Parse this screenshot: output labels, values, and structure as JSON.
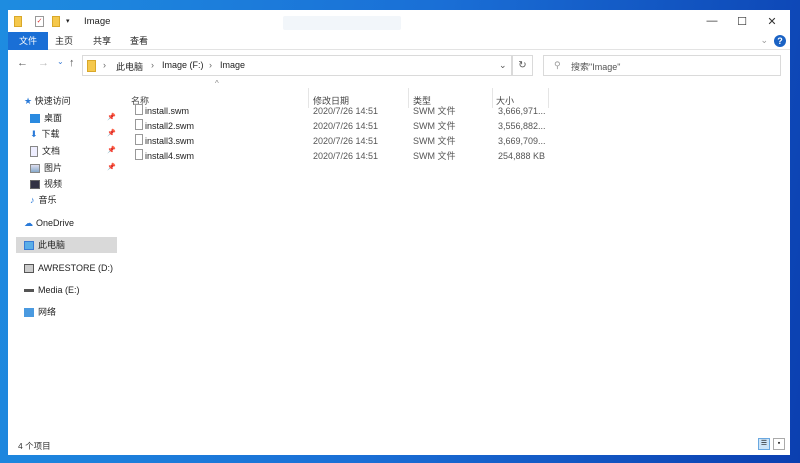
{
  "window": {
    "title": "Image",
    "minimize": "—",
    "maximize": "☐",
    "close": "✕"
  },
  "ribbon": {
    "tabs": [
      "文件",
      "主页",
      "共享",
      "查看"
    ],
    "help": "?",
    "expand": "⌄"
  },
  "nav": {
    "back": "←",
    "forward": "→",
    "recent": "⌄",
    "up": "↑"
  },
  "address": {
    "crumbs": [
      "此电脑",
      "Image (F:)",
      "Image"
    ],
    "sep": "›",
    "dropdown": "⌄",
    "refresh": "↻"
  },
  "search": {
    "placeholder": "搜索\"Image\"",
    "icon": "⚲"
  },
  "sidebar": {
    "quick_access": "快速访问",
    "items": [
      {
        "label": "桌面",
        "pinned": true
      },
      {
        "label": "下载",
        "pinned": true
      },
      {
        "label": "文档",
        "pinned": true
      },
      {
        "label": "图片",
        "pinned": true
      },
      {
        "label": "视频",
        "pinned": false
      },
      {
        "label": "音乐",
        "pinned": false
      }
    ],
    "onedrive": "OneDrive",
    "this_pc": "此电脑",
    "drives": [
      "AWRESTORE (D:)",
      "Media (E:)"
    ],
    "network": "网络"
  },
  "columns": {
    "name": "名称",
    "date": "修改日期",
    "type": "类型",
    "size": "大小",
    "sort": "^"
  },
  "files": [
    {
      "name": "install.swm",
      "date": "2020/7/26 14:51",
      "type": "SWM 文件",
      "size": "3,666,971..."
    },
    {
      "name": "install2.swm",
      "date": "2020/7/26 14:51",
      "type": "SWM 文件",
      "size": "3,556,882..."
    },
    {
      "name": "install3.swm",
      "date": "2020/7/26 14:51",
      "type": "SWM 文件",
      "size": "3,669,709..."
    },
    {
      "name": "install4.swm",
      "date": "2020/7/26 14:51",
      "type": "SWM 文件",
      "size": "254,888 KB"
    }
  ],
  "status": {
    "count": "4 个项目"
  }
}
